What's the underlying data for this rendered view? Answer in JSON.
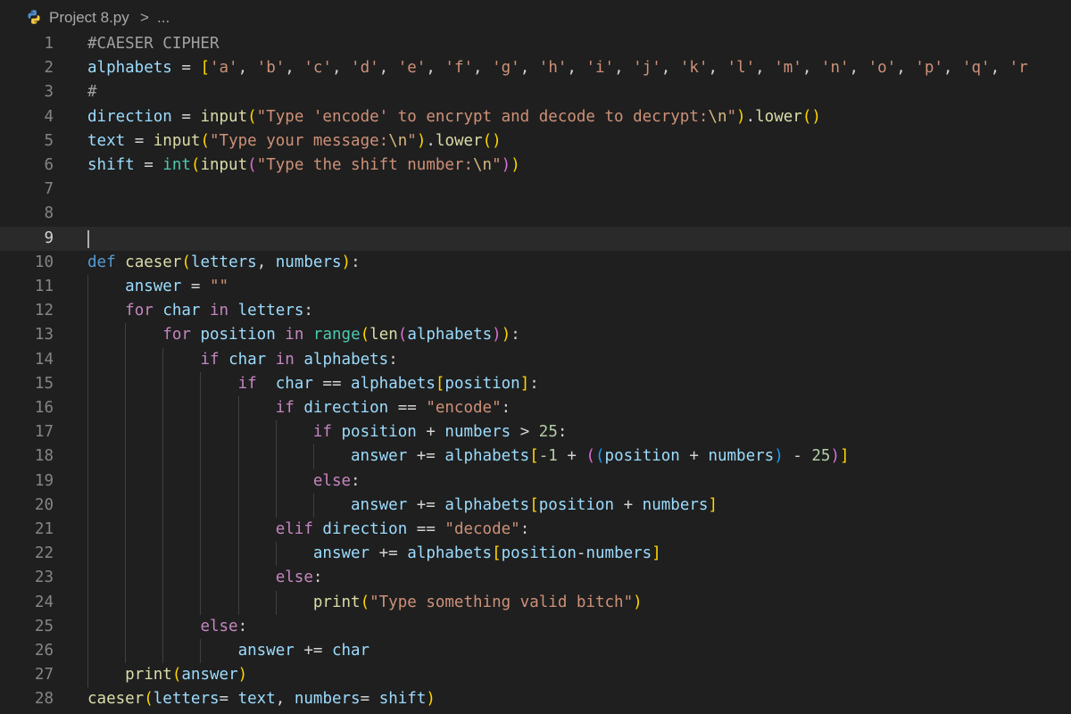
{
  "breadcrumb": {
    "file_name": "Project 8.py",
    "separator": ">",
    "more": "..."
  },
  "editor": {
    "active_line": 9,
    "lines": [
      {
        "n": "1",
        "tokens": [
          {
            "t": "#CAESER CIPHER",
            "c": "cmt"
          }
        ]
      },
      {
        "n": "2",
        "tokens": [
          {
            "t": "alphabets",
            "c": "var"
          },
          {
            "t": " = ",
            "c": "op"
          },
          {
            "t": "[",
            "c": "p1"
          },
          {
            "t": "'a'",
            "c": "str"
          },
          {
            "t": ", ",
            "c": "op"
          },
          {
            "t": "'b'",
            "c": "str"
          },
          {
            "t": ", ",
            "c": "op"
          },
          {
            "t": "'c'",
            "c": "str"
          },
          {
            "t": ", ",
            "c": "op"
          },
          {
            "t": "'d'",
            "c": "str"
          },
          {
            "t": ", ",
            "c": "op"
          },
          {
            "t": "'e'",
            "c": "str"
          },
          {
            "t": ", ",
            "c": "op"
          },
          {
            "t": "'f'",
            "c": "str"
          },
          {
            "t": ", ",
            "c": "op"
          },
          {
            "t": "'g'",
            "c": "str"
          },
          {
            "t": ", ",
            "c": "op"
          },
          {
            "t": "'h'",
            "c": "str"
          },
          {
            "t": ", ",
            "c": "op"
          },
          {
            "t": "'i'",
            "c": "str"
          },
          {
            "t": ", ",
            "c": "op"
          },
          {
            "t": "'j'",
            "c": "str"
          },
          {
            "t": ", ",
            "c": "op"
          },
          {
            "t": "'k'",
            "c": "str"
          },
          {
            "t": ", ",
            "c": "op"
          },
          {
            "t": "'l'",
            "c": "str"
          },
          {
            "t": ", ",
            "c": "op"
          },
          {
            "t": "'m'",
            "c": "str"
          },
          {
            "t": ", ",
            "c": "op"
          },
          {
            "t": "'n'",
            "c": "str"
          },
          {
            "t": ", ",
            "c": "op"
          },
          {
            "t": "'o'",
            "c": "str"
          },
          {
            "t": ", ",
            "c": "op"
          },
          {
            "t": "'p'",
            "c": "str"
          },
          {
            "t": ", ",
            "c": "op"
          },
          {
            "t": "'q'",
            "c": "str"
          },
          {
            "t": ", ",
            "c": "op"
          },
          {
            "t": "'r",
            "c": "str"
          }
        ]
      },
      {
        "n": "3",
        "tokens": [
          {
            "t": "#",
            "c": "cmt"
          }
        ]
      },
      {
        "n": "4",
        "tokens": [
          {
            "t": "direction",
            "c": "var"
          },
          {
            "t": " = ",
            "c": "op"
          },
          {
            "t": "input",
            "c": "fn"
          },
          {
            "t": "(",
            "c": "p1"
          },
          {
            "t": "\"Type 'encode' to encrypt and decode to decrypt:",
            "c": "str"
          },
          {
            "t": "\\n",
            "c": "esc"
          },
          {
            "t": "\"",
            "c": "str"
          },
          {
            "t": ")",
            "c": "p1"
          },
          {
            "t": ".",
            "c": "op"
          },
          {
            "t": "lower",
            "c": "fn"
          },
          {
            "t": "(",
            "c": "p1"
          },
          {
            "t": ")",
            "c": "p1"
          }
        ]
      },
      {
        "n": "5",
        "tokens": [
          {
            "t": "text",
            "c": "var"
          },
          {
            "t": " = ",
            "c": "op"
          },
          {
            "t": "input",
            "c": "fn"
          },
          {
            "t": "(",
            "c": "p1"
          },
          {
            "t": "\"Type your message:",
            "c": "str"
          },
          {
            "t": "\\n",
            "c": "esc"
          },
          {
            "t": "\"",
            "c": "str"
          },
          {
            "t": ")",
            "c": "p1"
          },
          {
            "t": ".",
            "c": "op"
          },
          {
            "t": "lower",
            "c": "fn"
          },
          {
            "t": "(",
            "c": "p1"
          },
          {
            "t": ")",
            "c": "p1"
          }
        ]
      },
      {
        "n": "6",
        "tokens": [
          {
            "t": "shift",
            "c": "var"
          },
          {
            "t": " = ",
            "c": "op"
          },
          {
            "t": "int",
            "c": "cls"
          },
          {
            "t": "(",
            "c": "p1"
          },
          {
            "t": "input",
            "c": "fn"
          },
          {
            "t": "(",
            "c": "p2"
          },
          {
            "t": "\"Type the shift number:",
            "c": "str"
          },
          {
            "t": "\\n",
            "c": "esc"
          },
          {
            "t": "\"",
            "c": "str"
          },
          {
            "t": ")",
            "c": "p2"
          },
          {
            "t": ")",
            "c": "p1"
          }
        ]
      },
      {
        "n": "7",
        "tokens": []
      },
      {
        "n": "8",
        "tokens": []
      },
      {
        "n": "9",
        "tokens": []
      },
      {
        "n": "10",
        "tokens": [
          {
            "t": "def",
            "c": "def"
          },
          {
            "t": " ",
            "c": "op"
          },
          {
            "t": "caeser",
            "c": "fn"
          },
          {
            "t": "(",
            "c": "p1"
          },
          {
            "t": "letters",
            "c": "prm"
          },
          {
            "t": ", ",
            "c": "op"
          },
          {
            "t": "numbers",
            "c": "prm"
          },
          {
            "t": ")",
            "c": "p1"
          },
          {
            "t": ":",
            "c": "op"
          }
        ]
      },
      {
        "n": "11",
        "tokens": [
          {
            "t": "    ",
            "c": "op"
          },
          {
            "t": "answer",
            "c": "var"
          },
          {
            "t": " = ",
            "c": "op"
          },
          {
            "t": "\"\"",
            "c": "str"
          }
        ]
      },
      {
        "n": "12",
        "tokens": [
          {
            "t": "    ",
            "c": "op"
          },
          {
            "t": "for",
            "c": "kw"
          },
          {
            "t": " ",
            "c": "op"
          },
          {
            "t": "char",
            "c": "var"
          },
          {
            "t": " ",
            "c": "op"
          },
          {
            "t": "in",
            "c": "kw"
          },
          {
            "t": " ",
            "c": "op"
          },
          {
            "t": "letters",
            "c": "var"
          },
          {
            "t": ":",
            "c": "op"
          }
        ]
      },
      {
        "n": "13",
        "tokens": [
          {
            "t": "        ",
            "c": "op"
          },
          {
            "t": "for",
            "c": "kw"
          },
          {
            "t": " ",
            "c": "op"
          },
          {
            "t": "position",
            "c": "var"
          },
          {
            "t": " ",
            "c": "op"
          },
          {
            "t": "in",
            "c": "kw"
          },
          {
            "t": " ",
            "c": "op"
          },
          {
            "t": "range",
            "c": "cls"
          },
          {
            "t": "(",
            "c": "p1"
          },
          {
            "t": "len",
            "c": "fn"
          },
          {
            "t": "(",
            "c": "p2"
          },
          {
            "t": "alphabets",
            "c": "var"
          },
          {
            "t": ")",
            "c": "p2"
          },
          {
            "t": ")",
            "c": "p1"
          },
          {
            "t": ":",
            "c": "op"
          }
        ]
      },
      {
        "n": "14",
        "tokens": [
          {
            "t": "            ",
            "c": "op"
          },
          {
            "t": "if",
            "c": "kw"
          },
          {
            "t": " ",
            "c": "op"
          },
          {
            "t": "char",
            "c": "var"
          },
          {
            "t": " ",
            "c": "op"
          },
          {
            "t": "in",
            "c": "kw"
          },
          {
            "t": " ",
            "c": "op"
          },
          {
            "t": "alphabets",
            "c": "var"
          },
          {
            "t": ":",
            "c": "op"
          }
        ]
      },
      {
        "n": "15",
        "tokens": [
          {
            "t": "                ",
            "c": "op"
          },
          {
            "t": "if",
            "c": "kw"
          },
          {
            "t": "  ",
            "c": "op"
          },
          {
            "t": "char",
            "c": "var"
          },
          {
            "t": " == ",
            "c": "op"
          },
          {
            "t": "alphabets",
            "c": "var"
          },
          {
            "t": "[",
            "c": "p1"
          },
          {
            "t": "position",
            "c": "var"
          },
          {
            "t": "]",
            "c": "p1"
          },
          {
            "t": ":",
            "c": "op"
          }
        ]
      },
      {
        "n": "16",
        "tokens": [
          {
            "t": "                    ",
            "c": "op"
          },
          {
            "t": "if",
            "c": "kw"
          },
          {
            "t": " ",
            "c": "op"
          },
          {
            "t": "direction",
            "c": "var"
          },
          {
            "t": " == ",
            "c": "op"
          },
          {
            "t": "\"encode\"",
            "c": "str"
          },
          {
            "t": ":",
            "c": "op"
          }
        ]
      },
      {
        "n": "17",
        "tokens": [
          {
            "t": "                        ",
            "c": "op"
          },
          {
            "t": "if",
            "c": "kw"
          },
          {
            "t": " ",
            "c": "op"
          },
          {
            "t": "position",
            "c": "var"
          },
          {
            "t": " + ",
            "c": "op"
          },
          {
            "t": "numbers",
            "c": "prm"
          },
          {
            "t": " > ",
            "c": "op"
          },
          {
            "t": "25",
            "c": "num"
          },
          {
            "t": ":",
            "c": "op"
          }
        ]
      },
      {
        "n": "18",
        "tokens": [
          {
            "t": "                            ",
            "c": "op"
          },
          {
            "t": "answer",
            "c": "var"
          },
          {
            "t": " += ",
            "c": "op"
          },
          {
            "t": "alphabets",
            "c": "var"
          },
          {
            "t": "[",
            "c": "p1"
          },
          {
            "t": "-1",
            "c": "num"
          },
          {
            "t": " + ",
            "c": "op"
          },
          {
            "t": "(",
            "c": "p2"
          },
          {
            "t": "(",
            "c": "p3"
          },
          {
            "t": "position",
            "c": "var"
          },
          {
            "t": " + ",
            "c": "op"
          },
          {
            "t": "numbers",
            "c": "prm"
          },
          {
            "t": ")",
            "c": "p3"
          },
          {
            "t": " - ",
            "c": "op"
          },
          {
            "t": "25",
            "c": "num"
          },
          {
            "t": ")",
            "c": "p2"
          },
          {
            "t": "]",
            "c": "p1"
          }
        ]
      },
      {
        "n": "19",
        "tokens": [
          {
            "t": "                        ",
            "c": "op"
          },
          {
            "t": "else",
            "c": "kw"
          },
          {
            "t": ":",
            "c": "op"
          }
        ]
      },
      {
        "n": "20",
        "tokens": [
          {
            "t": "                            ",
            "c": "op"
          },
          {
            "t": "answer",
            "c": "var"
          },
          {
            "t": " += ",
            "c": "op"
          },
          {
            "t": "alphabets",
            "c": "var"
          },
          {
            "t": "[",
            "c": "p1"
          },
          {
            "t": "position",
            "c": "var"
          },
          {
            "t": " + ",
            "c": "op"
          },
          {
            "t": "numbers",
            "c": "prm"
          },
          {
            "t": "]",
            "c": "p1"
          }
        ]
      },
      {
        "n": "21",
        "tokens": [
          {
            "t": "                    ",
            "c": "op"
          },
          {
            "t": "elif",
            "c": "kw"
          },
          {
            "t": " ",
            "c": "op"
          },
          {
            "t": "direction",
            "c": "var"
          },
          {
            "t": " == ",
            "c": "op"
          },
          {
            "t": "\"decode\"",
            "c": "str"
          },
          {
            "t": ":",
            "c": "op"
          }
        ]
      },
      {
        "n": "22",
        "tokens": [
          {
            "t": "                        ",
            "c": "op"
          },
          {
            "t": "answer",
            "c": "var"
          },
          {
            "t": " += ",
            "c": "op"
          },
          {
            "t": "alphabets",
            "c": "var"
          },
          {
            "t": "[",
            "c": "p1"
          },
          {
            "t": "position",
            "c": "var"
          },
          {
            "t": "-",
            "c": "op"
          },
          {
            "t": "numbers",
            "c": "prm"
          },
          {
            "t": "]",
            "c": "p1"
          }
        ]
      },
      {
        "n": "23",
        "tokens": [
          {
            "t": "                    ",
            "c": "op"
          },
          {
            "t": "else",
            "c": "kw"
          },
          {
            "t": ":",
            "c": "op"
          }
        ]
      },
      {
        "n": "24",
        "tokens": [
          {
            "t": "                        ",
            "c": "op"
          },
          {
            "t": "print",
            "c": "fn"
          },
          {
            "t": "(",
            "c": "p1"
          },
          {
            "t": "\"Type something valid bitch\"",
            "c": "str"
          },
          {
            "t": ")",
            "c": "p1"
          }
        ]
      },
      {
        "n": "25",
        "tokens": [
          {
            "t": "            ",
            "c": "op"
          },
          {
            "t": "else",
            "c": "kw"
          },
          {
            "t": ":",
            "c": "op"
          }
        ]
      },
      {
        "n": "26",
        "tokens": [
          {
            "t": "                ",
            "c": "op"
          },
          {
            "t": "answer",
            "c": "var"
          },
          {
            "t": " += ",
            "c": "op"
          },
          {
            "t": "char",
            "c": "var"
          }
        ]
      },
      {
        "n": "27",
        "tokens": [
          {
            "t": "    ",
            "c": "op"
          },
          {
            "t": "print",
            "c": "fn"
          },
          {
            "t": "(",
            "c": "p1"
          },
          {
            "t": "answer",
            "c": "var"
          },
          {
            "t": ")",
            "c": "p1"
          }
        ]
      },
      {
        "n": "28",
        "tokens": [
          {
            "t": "caeser",
            "c": "fn"
          },
          {
            "t": "(",
            "c": "p1"
          },
          {
            "t": "letters",
            "c": "prm"
          },
          {
            "t": "= ",
            "c": "op"
          },
          {
            "t": "text",
            "c": "var"
          },
          {
            "t": ", ",
            "c": "op"
          },
          {
            "t": "numbers",
            "c": "prm"
          },
          {
            "t": "= ",
            "c": "op"
          },
          {
            "t": "shift",
            "c": "var"
          },
          {
            "t": ")",
            "c": "p1"
          }
        ]
      }
    ]
  }
}
